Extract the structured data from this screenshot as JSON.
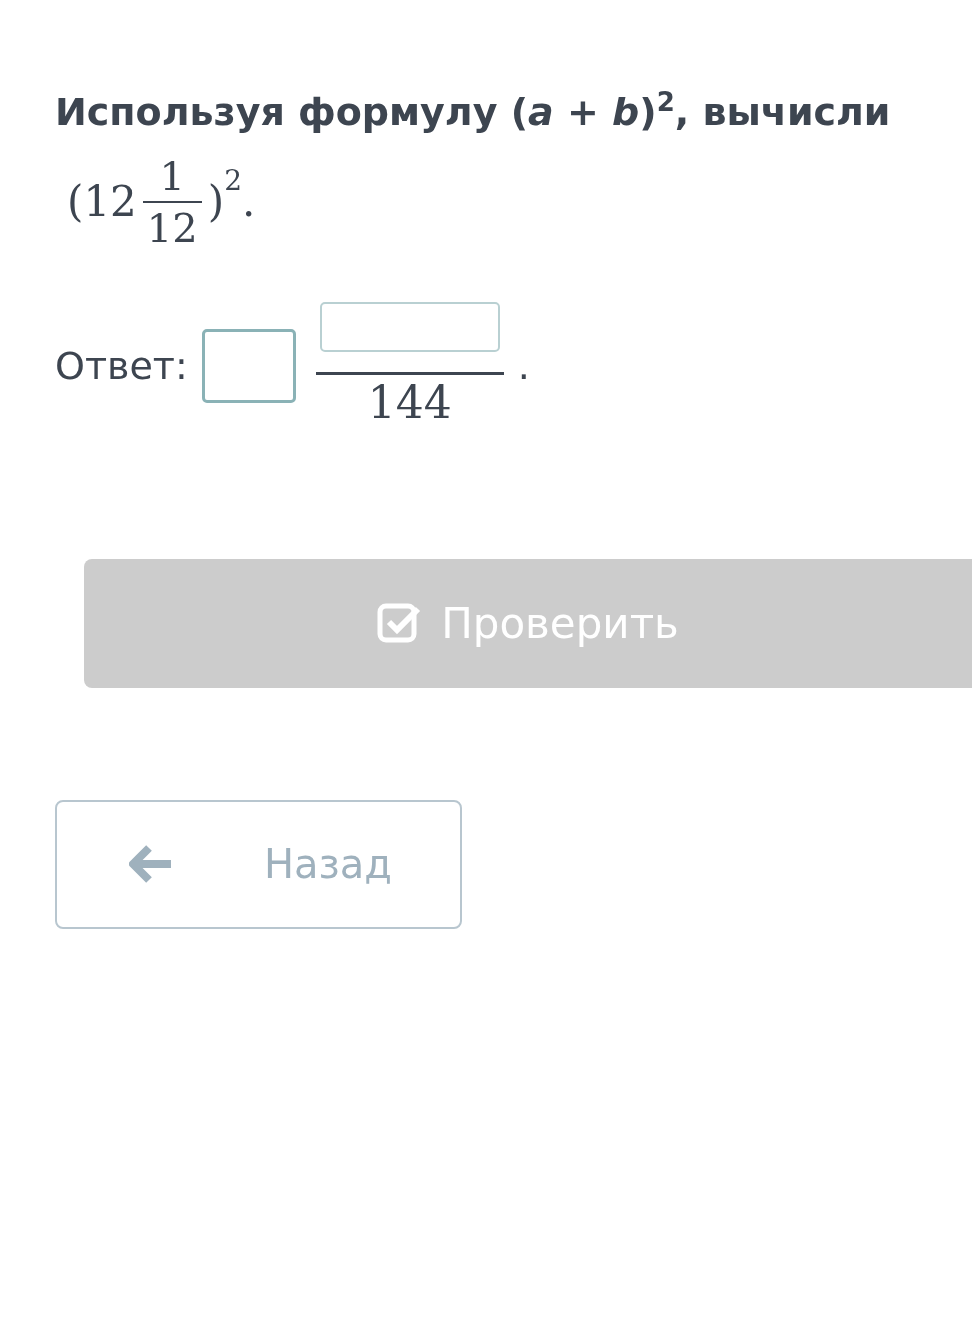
{
  "question": {
    "text": "Используя формулу (*a* + *b*)$^{2}$, вычисли",
    "expression": {
      "open": "(",
      "whole": "12",
      "numerator": "1",
      "denominator": "12",
      "close": ")",
      "power": "2",
      "end": "."
    }
  },
  "answer": {
    "label": "Ответ:",
    "whole_field": {
      "focused": true
    },
    "numerator_field": {
      "focused": false
    },
    "denominator": "144",
    "end": "."
  },
  "check_button": {
    "label": "Проверить",
    "disabled": true
  },
  "back_button": {
    "label": "Назад"
  }
}
